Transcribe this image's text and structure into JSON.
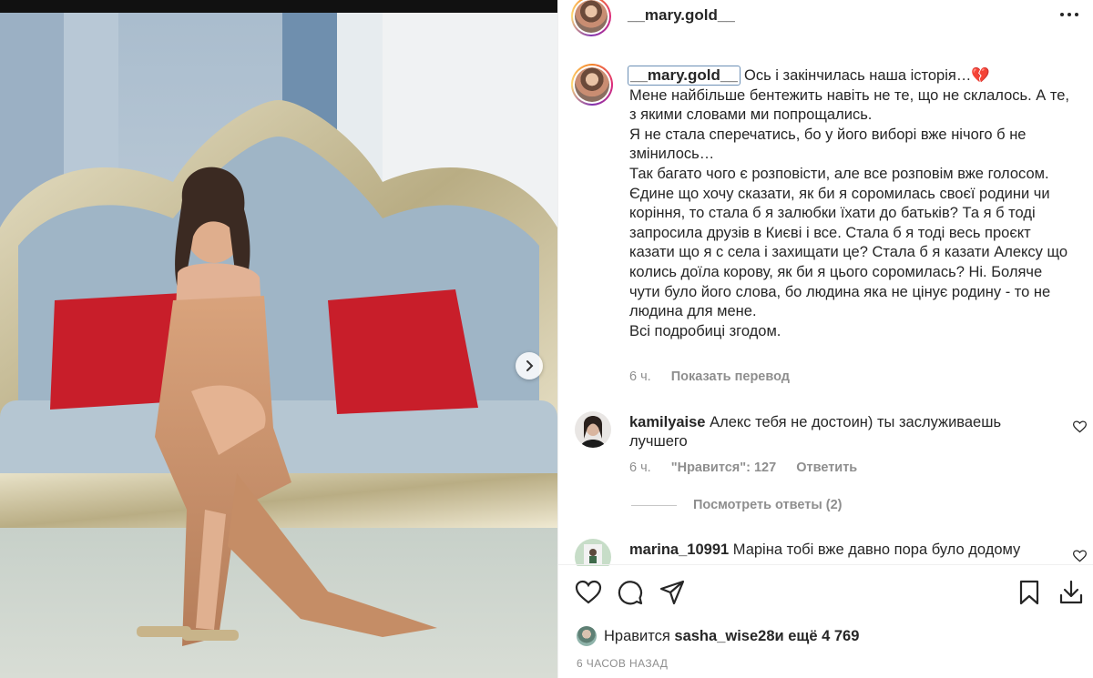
{
  "post": {
    "username": "__mary.gold__"
  },
  "caption": {
    "username": "__mary.gold__",
    "lines": [
      "Ось і закінчилась наша історія…💔",
      "Мене найбільше бентежить навіть не те, що не склалось. А те, з якими словами ми попрощались.",
      "Я не стала сперечатись, бо у його виборі вже нічого б не змінилось…",
      "Так багато чого є розповісти, але все розповім вже голосом.",
      "Єдине що хочу сказати, як би я соромилась своєї родини чи коріння, то стала б я залюбки їхати до батьків? Та я б тоді запросила друзів в Києві і все. Стала б я тоді весь проєкт казати що я с села і захищати це? Стала б я казати Алексу що колись доїла корову, як би я цього соромилась? Ні. Боляче чути було його слова, бо людина яка не цінує родину - то не людина для мене.",
      "Всі подробиці згодом."
    ],
    "time": "6 ч.",
    "translate": "Показать перевод"
  },
  "comments": [
    {
      "username": "kamilyaise",
      "text": "Алекс тебя не достоин) ты заслуживаешь лучшего",
      "time": "6 ч.",
      "likes": "\"Нравится\": 127",
      "reply": "Ответить"
    },
    {
      "username": "marina_10991",
      "text": "Маріна тобі вже давно пора було додому"
    }
  ],
  "replies_label": "Посмотреть ответы (2)",
  "likes_summary": {
    "prefix": "Нравится ",
    "user": "sasha_wise28",
    "suffix": " и ещё 4 769"
  },
  "timestamp": "6 ЧАСОВ НАЗАД",
  "icons": {
    "more": "ellipsis-icon",
    "like": "heart-icon",
    "comment": "comment-icon",
    "share": "paper-plane-icon",
    "save": "bookmark-icon",
    "download": "download-icon",
    "next": "chevron-right-icon"
  },
  "colors": {
    "text": "#262626",
    "secondary": "#8e8e8e",
    "divider": "#efefef"
  }
}
